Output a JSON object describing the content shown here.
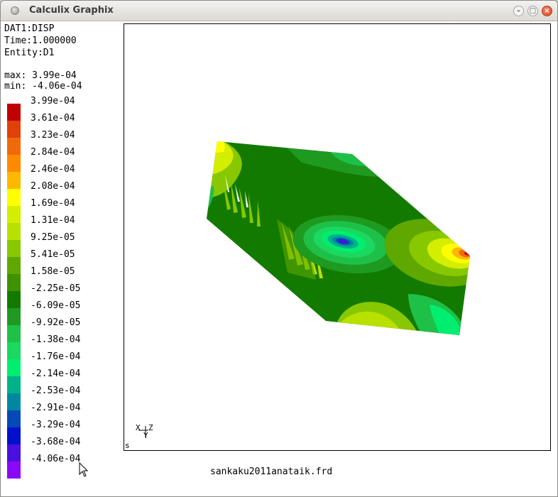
{
  "window": {
    "title": "Calculix Graphix"
  },
  "info": {
    "dataset": "DAT1:DISP",
    "time": "Time:1.000000",
    "entity": "Entity:D1",
    "max": "max: 3.99e-04",
    "min": "min: -4.06e-04"
  },
  "legend": [
    {
      "value": "3.99e-04",
      "color": "#c00000"
    },
    {
      "value": "3.61e-04",
      "color": "#e0400a"
    },
    {
      "value": "3.23e-04",
      "color": "#f06a0a"
    },
    {
      "value": "2.84e-04",
      "color": "#ff8a00"
    },
    {
      "value": "2.46e-04",
      "color": "#ffb800"
    },
    {
      "value": "2.08e-04",
      "color": "#ffff00"
    },
    {
      "value": "1.69e-04",
      "color": "#d4ee00"
    },
    {
      "value": "1.31e-04",
      "color": "#b8e000"
    },
    {
      "value": "9.25e-05",
      "color": "#88c800"
    },
    {
      "value": "5.41e-05",
      "color": "#5ea800"
    },
    {
      "value": "1.58e-05",
      "color": "#3f9200"
    },
    {
      "value": "-2.25e-05",
      "color": "#137a00"
    },
    {
      "value": "-6.09e-05",
      "color": "#1f9a20"
    },
    {
      "value": "-9.92e-05",
      "color": "#1ec048"
    },
    {
      "value": "-1.38e-04",
      "color": "#1ad860"
    },
    {
      "value": "-1.76e-04",
      "color": "#00ee70"
    },
    {
      "value": "-2.14e-04",
      "color": "#00b28a"
    },
    {
      "value": "-2.53e-04",
      "color": "#0088a0"
    },
    {
      "value": "-2.91e-04",
      "color": "#0548b8"
    },
    {
      "value": "-3.29e-04",
      "color": "#0010cc"
    },
    {
      "value": "-3.68e-04",
      "color": "#4a10e0"
    },
    {
      "value": "-4.06e-04",
      "color": "#8a08f8"
    }
  ],
  "viewport": {
    "axes": "x z\n y",
    "corner_label": "s"
  },
  "filename": "sankaku2011anataik.frd"
}
